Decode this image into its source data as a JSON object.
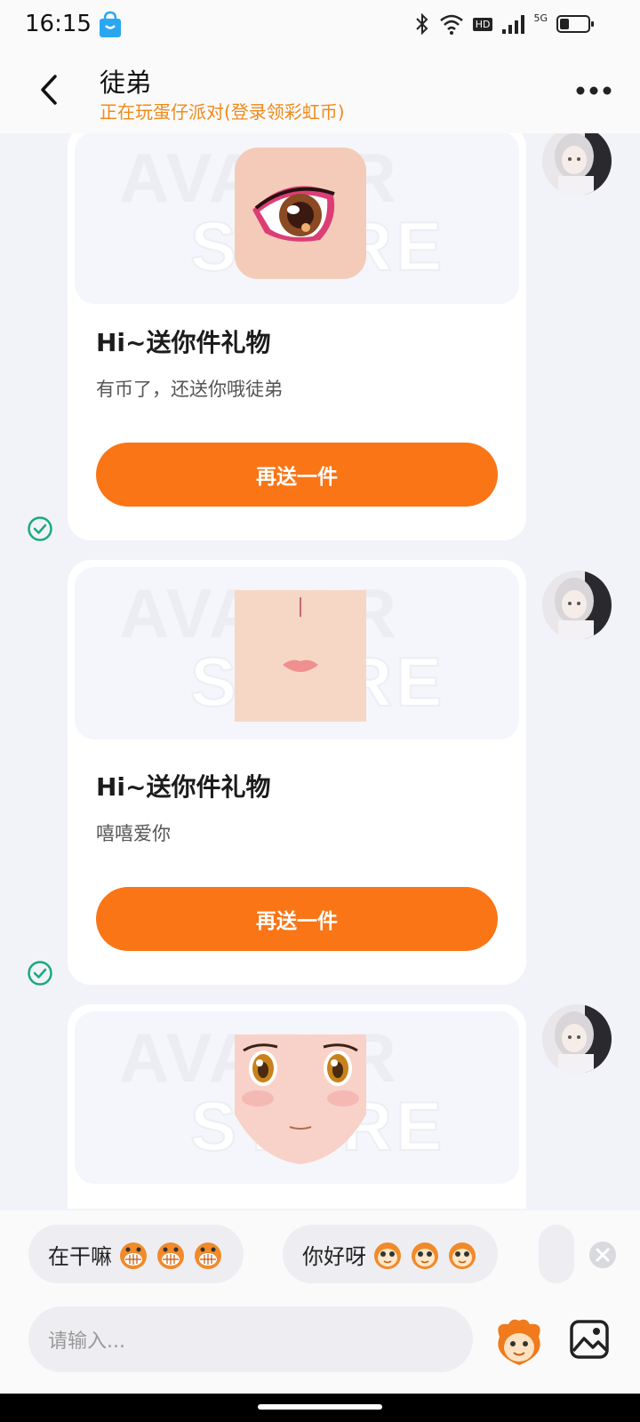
{
  "status_bar": {
    "time": "16:15",
    "hd_label": "HD",
    "network_label": "5G"
  },
  "header": {
    "title": "徒弟",
    "subtitle": "正在玩蛋仔派对(登录领彩虹币)"
  },
  "watermark": {
    "line1": "AVATAR",
    "line2": "STORE"
  },
  "messages": [
    {
      "title": "Hi~送你件礼物",
      "text": "有币了，还送你哦徒弟",
      "button": "再送一件",
      "gift": "eye-makeup"
    },
    {
      "title": "Hi~送你件礼物",
      "text": "嘻嘻爱你",
      "button": "再送一件",
      "gift": "face-lips"
    },
    {
      "title": "",
      "text": "",
      "button": "",
      "gift": "anime-face"
    }
  ],
  "quick_replies": [
    {
      "text": "在干嘛",
      "emoji_count": 3
    },
    {
      "text": "你好呀",
      "emoji_count": 3
    }
  ],
  "input": {
    "placeholder": "请输入..."
  },
  "colors": {
    "accent": "#fa7516",
    "subtitle": "#f08a1c",
    "check": "#1aaa7a",
    "background": "#f1f3f9"
  }
}
